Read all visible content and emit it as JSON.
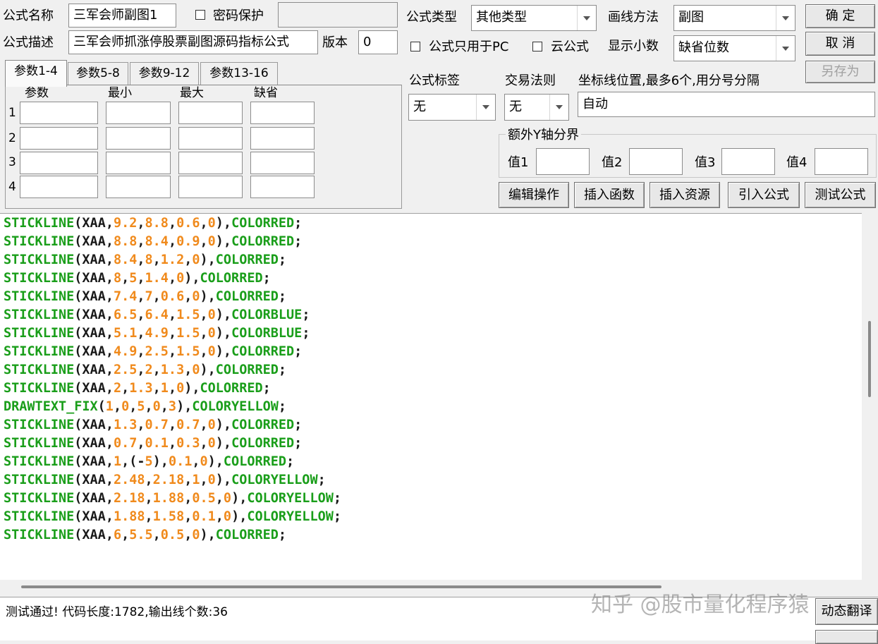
{
  "header": {
    "formula_name_label": "公式名称",
    "formula_name_value": "三军会师副图1",
    "password_label": "密码保护",
    "password_value": "",
    "formula_desc_label": "公式描述",
    "formula_desc_value": "三军会师抓涨停股票副图源码指标公式",
    "version_label": "版本",
    "version_value": "0",
    "formula_type_label": "公式类型",
    "formula_type_value": "其他类型",
    "draw_method_label": "画线方法",
    "draw_method_value": "副图",
    "pc_only_label": "公式只用于PC",
    "cloud_label": "云公式",
    "decimals_label": "显示小数",
    "decimals_value": "缺省位数"
  },
  "buttons": {
    "ok": "确  定",
    "cancel": "取  消",
    "save_as": "另存为"
  },
  "params": {
    "tabs": [
      "参数1-4",
      "参数5-8",
      "参数9-12",
      "参数13-16"
    ],
    "columns": [
      "参数",
      "最小",
      "最大",
      "缺省"
    ],
    "rows": [
      "1",
      "2",
      "3",
      "4"
    ]
  },
  "options": {
    "tag_label": "公式标签",
    "tag_value": "无",
    "trade_rule_label": "交易法则",
    "trade_rule_value": "无",
    "axis_label": "坐标线位置,最多6个,用分号分隔",
    "axis_value": "自动",
    "yaxis_group_label": "额外Y轴分界",
    "yaxis_values": [
      "值1",
      "值2",
      "值3",
      "值4"
    ]
  },
  "actions": [
    "编辑操作",
    "插入函数",
    "插入资源",
    "引入公式",
    "测试公式"
  ],
  "code_lines": [
    "STICKLINE(XAA,9.2,8.8,0.6,0),COLORRED;",
    "STICKLINE(XAA,8.8,8.4,0.9,0),COLORRED;",
    "STICKLINE(XAA,8.4,8,1.2,0),COLORRED;",
    "STICKLINE(XAA,8,5,1.4,0),COLORRED;",
    "STICKLINE(XAA,7.4,7,0.6,0),COLORRED;",
    "STICKLINE(XAA,6.5,6.4,1.5,0),COLORBLUE;",
    "STICKLINE(XAA,5.1,4.9,1.5,0),COLORBLUE;",
    "STICKLINE(XAA,4.9,2.5,1.5,0),COLORRED;",
    "STICKLINE(XAA,2.5,2,1.3,0),COLORRED;",
    "STICKLINE(XAA,2,1.3,1,0),COLORRED;",
    "DRAWTEXT_FIX(1,0,5,0,3),COLORYELLOW;",
    "STICKLINE(XAA,1.3,0.7,0.7,0),COLORRED;",
    "STICKLINE(XAA,0.7,0.1,0.3,0),COLORRED;",
    "STICKLINE(XAA,1,(-5),0.1,0),COLORRED;",
    "STICKLINE(XAA,2.48,2.18,1,0),COLORYELLOW;",
    "STICKLINE(XAA,2.18,1.88,0.5,0),COLORYELLOW;",
    "STICKLINE(XAA,1.88,1.58,0.1,0),COLORYELLOW;",
    "STICKLINE(XAA,6,5.5,0.5,0),COLORRED;"
  ],
  "status": {
    "message": "测试通过! 代码长度:1782,输出线个数:36",
    "watermark": "知乎 @股市量化程序猿",
    "translate_button": "动态翻译"
  },
  "colors": {
    "keyword": "#1a9e1a",
    "number": "#f08a1c",
    "background": "#f0f0f0"
  }
}
